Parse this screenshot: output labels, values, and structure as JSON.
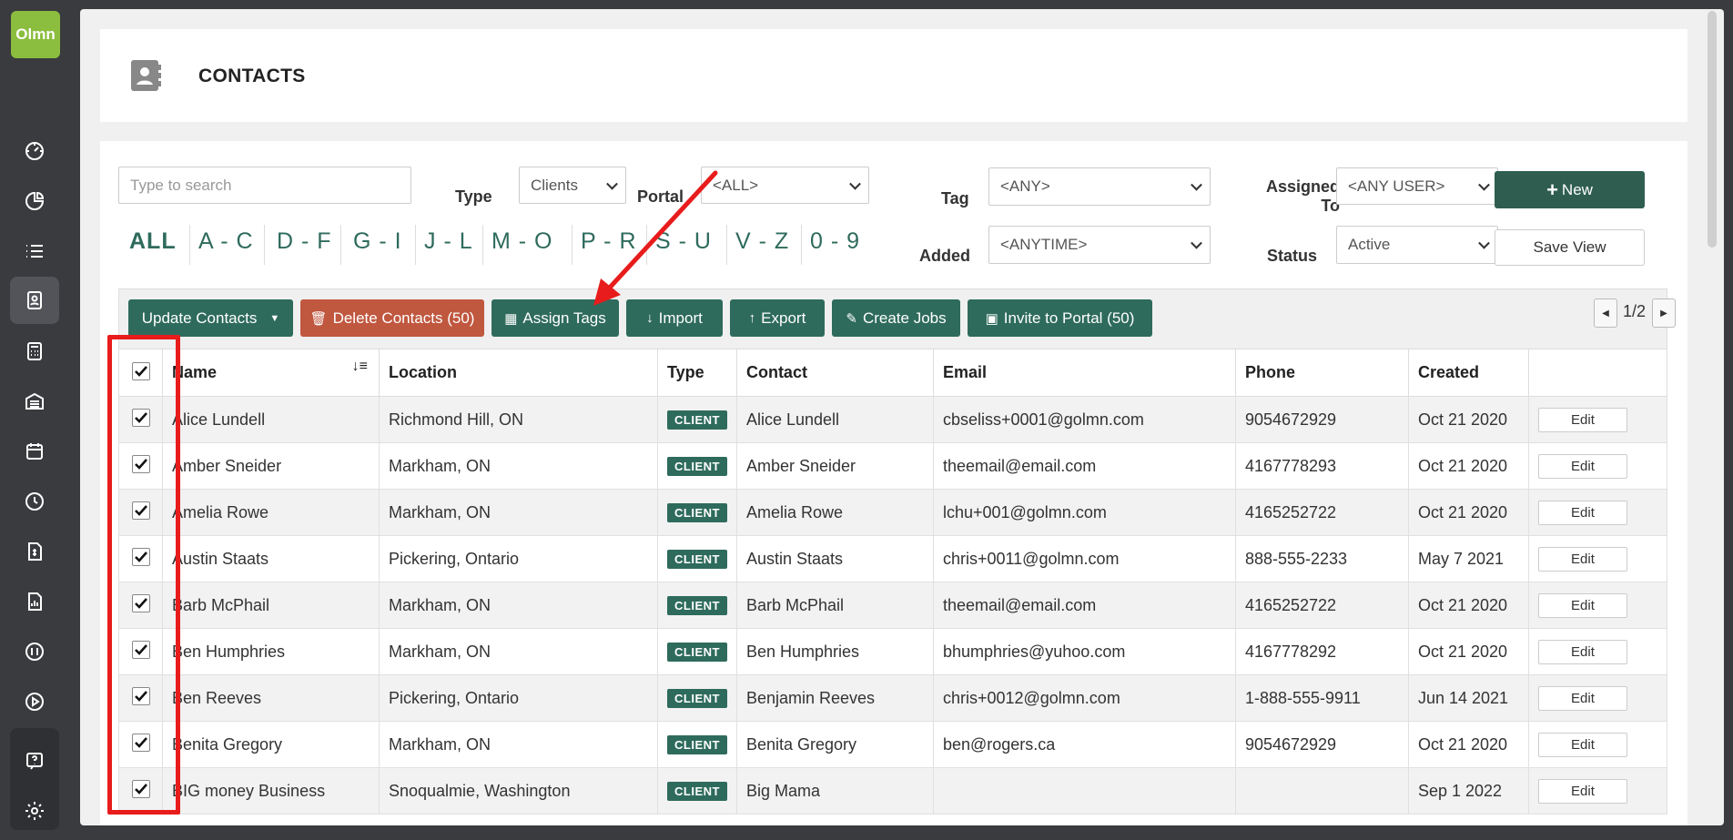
{
  "logo": {
    "text": "Olmn"
  },
  "sidebar": {
    "items": [
      {
        "name": "dashboard-icon"
      },
      {
        "name": "pie-chart-icon"
      },
      {
        "name": "list-icon"
      },
      {
        "name": "contacts-icon",
        "active": true
      },
      {
        "name": "calculator-icon"
      },
      {
        "name": "warehouse-icon"
      },
      {
        "name": "calendar-icon"
      },
      {
        "name": "clock-icon"
      },
      {
        "name": "invoice-icon"
      },
      {
        "name": "report-icon"
      },
      {
        "name": "quickbooks-icon"
      },
      {
        "name": "play-icon"
      }
    ],
    "bottom": [
      {
        "name": "help-icon"
      },
      {
        "name": "gear-icon"
      }
    ]
  },
  "header": {
    "title": "CONTACTS"
  },
  "filters": {
    "search_placeholder": "Type to search",
    "type_label": "Type",
    "type_value": "Clients",
    "portal_label": "Portal",
    "portal_value": "<ALL>",
    "tag_label": "Tag",
    "tag_value": "<ANY>",
    "assigned_label_1": "Assigned",
    "assigned_label_2": "To",
    "assigned_value": "<ANY USER>",
    "added_label": "Added",
    "added_value": "<ANYTIME>",
    "status_label": "Status",
    "status_value": "Active",
    "new_label": "New",
    "save_view_label": "Save View"
  },
  "alphabet": [
    "ALL",
    "A - C",
    "D - F",
    "G - I",
    "J - L",
    "M - O",
    "P - R",
    "S - U",
    "V - Z",
    "0 - 9"
  ],
  "toolbar": {
    "update": "Update Contacts",
    "delete": "Delete Contacts (50)",
    "assign_tags": "Assign Tags",
    "import": "Import",
    "export": "Export",
    "create_jobs": "Create Jobs",
    "invite": "Invite to Portal (50)",
    "pager": "1/2"
  },
  "table": {
    "headers": [
      "Name",
      "Location",
      "Type",
      "Contact",
      "Email",
      "Phone",
      "Created",
      ""
    ],
    "edit_label": "Edit",
    "rows": [
      {
        "name": "Alice Lundell",
        "location": "Richmond Hill, ON",
        "type": "CLIENT",
        "contact": "Alice Lundell",
        "email": "cbseliss+0001@golmn.com",
        "phone": "9054672929",
        "created": "Oct 21 2020"
      },
      {
        "name": "Amber Sneider",
        "location": "Markham, ON",
        "type": "CLIENT",
        "contact": "Amber Sneider",
        "email": "theemail@email.com",
        "phone": "4167778293",
        "created": "Oct 21 2020"
      },
      {
        "name": "Amelia Rowe",
        "location": "Markham, ON",
        "type": "CLIENT",
        "contact": "Amelia Rowe",
        "email": "lchu+001@golmn.com",
        "phone": "4165252722",
        "created": "Oct 21 2020"
      },
      {
        "name": "Austin Staats",
        "location": "Pickering, Ontario",
        "type": "CLIENT",
        "contact": "Austin Staats",
        "email": "chris+0011@golmn.com",
        "phone": "888-555-2233",
        "created": "May 7 2021"
      },
      {
        "name": "Barb McPhail",
        "location": "Markham, ON",
        "type": "CLIENT",
        "contact": "Barb McPhail",
        "email": "theemail@email.com",
        "phone": "4165252722",
        "created": "Oct 21 2020"
      },
      {
        "name": "Ben Humphries",
        "location": "Markham, ON",
        "type": "CLIENT",
        "contact": "Ben Humphries",
        "email": "bhumphries@yuhoo.com",
        "phone": "4167778292",
        "created": "Oct 21 2020"
      },
      {
        "name": "Ben Reeves",
        "location": "Pickering, Ontario",
        "type": "CLIENT",
        "contact": "Benjamin Reeves",
        "email": "chris+0012@golmn.com",
        "phone": "1-888-555-9911",
        "created": "Jun 14 2021"
      },
      {
        "name": "Benita Gregory",
        "location": "Markham, ON",
        "type": "CLIENT",
        "contact": "Benita Gregory",
        "email": "ben@rogers.ca",
        "phone": "9054672929",
        "created": "Oct 21 2020"
      },
      {
        "name": "BIG money Business",
        "location": "Snoqualmie, Washington",
        "type": "CLIENT",
        "contact": "Big Mama",
        "email": "",
        "phone": "",
        "created": "Sep 1 2022"
      }
    ]
  },
  "colors": {
    "brand_green": "#2e6b5c",
    "danger": "#c0573f",
    "logo_green": "#8bbd3f",
    "annotation_red": "#e81c1c"
  }
}
